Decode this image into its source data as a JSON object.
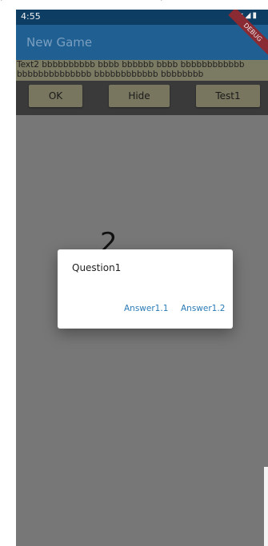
{
  "status_bar": {
    "time": "4:55"
  },
  "app_bar": {
    "title": "New Game"
  },
  "debug_banner": {
    "label": "DEBUG"
  },
  "text_banner": {
    "line1": "Text2 bbbbbbbbbb bbbb  bbbbbb  bbbb bbbbbbbbbbbb",
    "line2": "bbbbbbbbbbbbbb bbbbbbbbbbbb bbbbbbbb"
  },
  "toolbar": {
    "ok_label": "OK",
    "hide_label": "Hide",
    "test1_label": "Test1"
  },
  "board": {
    "digit": "2"
  },
  "dialog": {
    "question": "Question1",
    "answers": [
      "Answer1.1",
      "Answer1.2"
    ]
  },
  "colors": {
    "status_bar": "#0e3d63",
    "app_bar": "#205f91",
    "accent_link": "#2a7bb5",
    "scrim": "#777777",
    "button_bg": "#78765f"
  }
}
